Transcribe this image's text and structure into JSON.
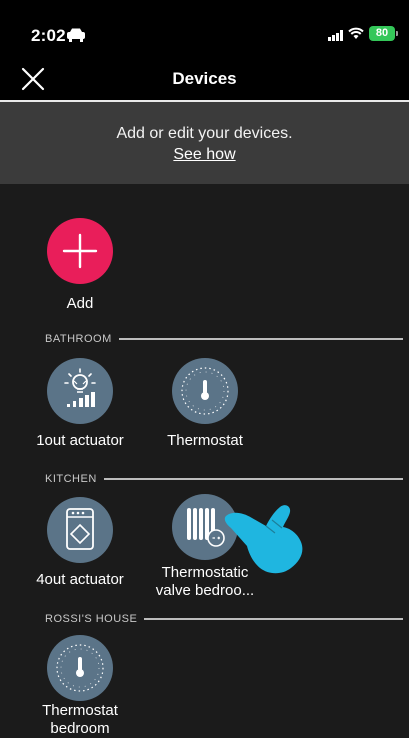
{
  "status_bar": {
    "time": "2:02",
    "battery": "80"
  },
  "nav": {
    "title": "Devices"
  },
  "banner": {
    "text": "Add or edit your devices.",
    "link": "See how"
  },
  "add": {
    "label": "Add"
  },
  "sections": {
    "bathroom": {
      "title": "BATHROOM",
      "devices": [
        {
          "label": "1out actuator",
          "icon": "light-actuator-icon"
        },
        {
          "label": "Thermostat",
          "icon": "thermostat-icon"
        }
      ]
    },
    "kitchen": {
      "title": "KITCHEN",
      "devices": [
        {
          "label": "4out actuator",
          "icon": "actuator-box-icon"
        },
        {
          "label_line1": "Thermostatic",
          "label_line2": "valve bedroo...",
          "icon": "thermostatic-valve-icon"
        }
      ]
    },
    "rossis_house": {
      "title": "ROSSI'S HOUSE",
      "devices": [
        {
          "label_line1": "Thermostat",
          "label_line2": "bedroom",
          "icon": "thermostat-icon"
        }
      ]
    }
  },
  "colors": {
    "accent": "#e91e5a",
    "icon_bg": "#5b7488",
    "pointer": "#1fb6e0"
  }
}
